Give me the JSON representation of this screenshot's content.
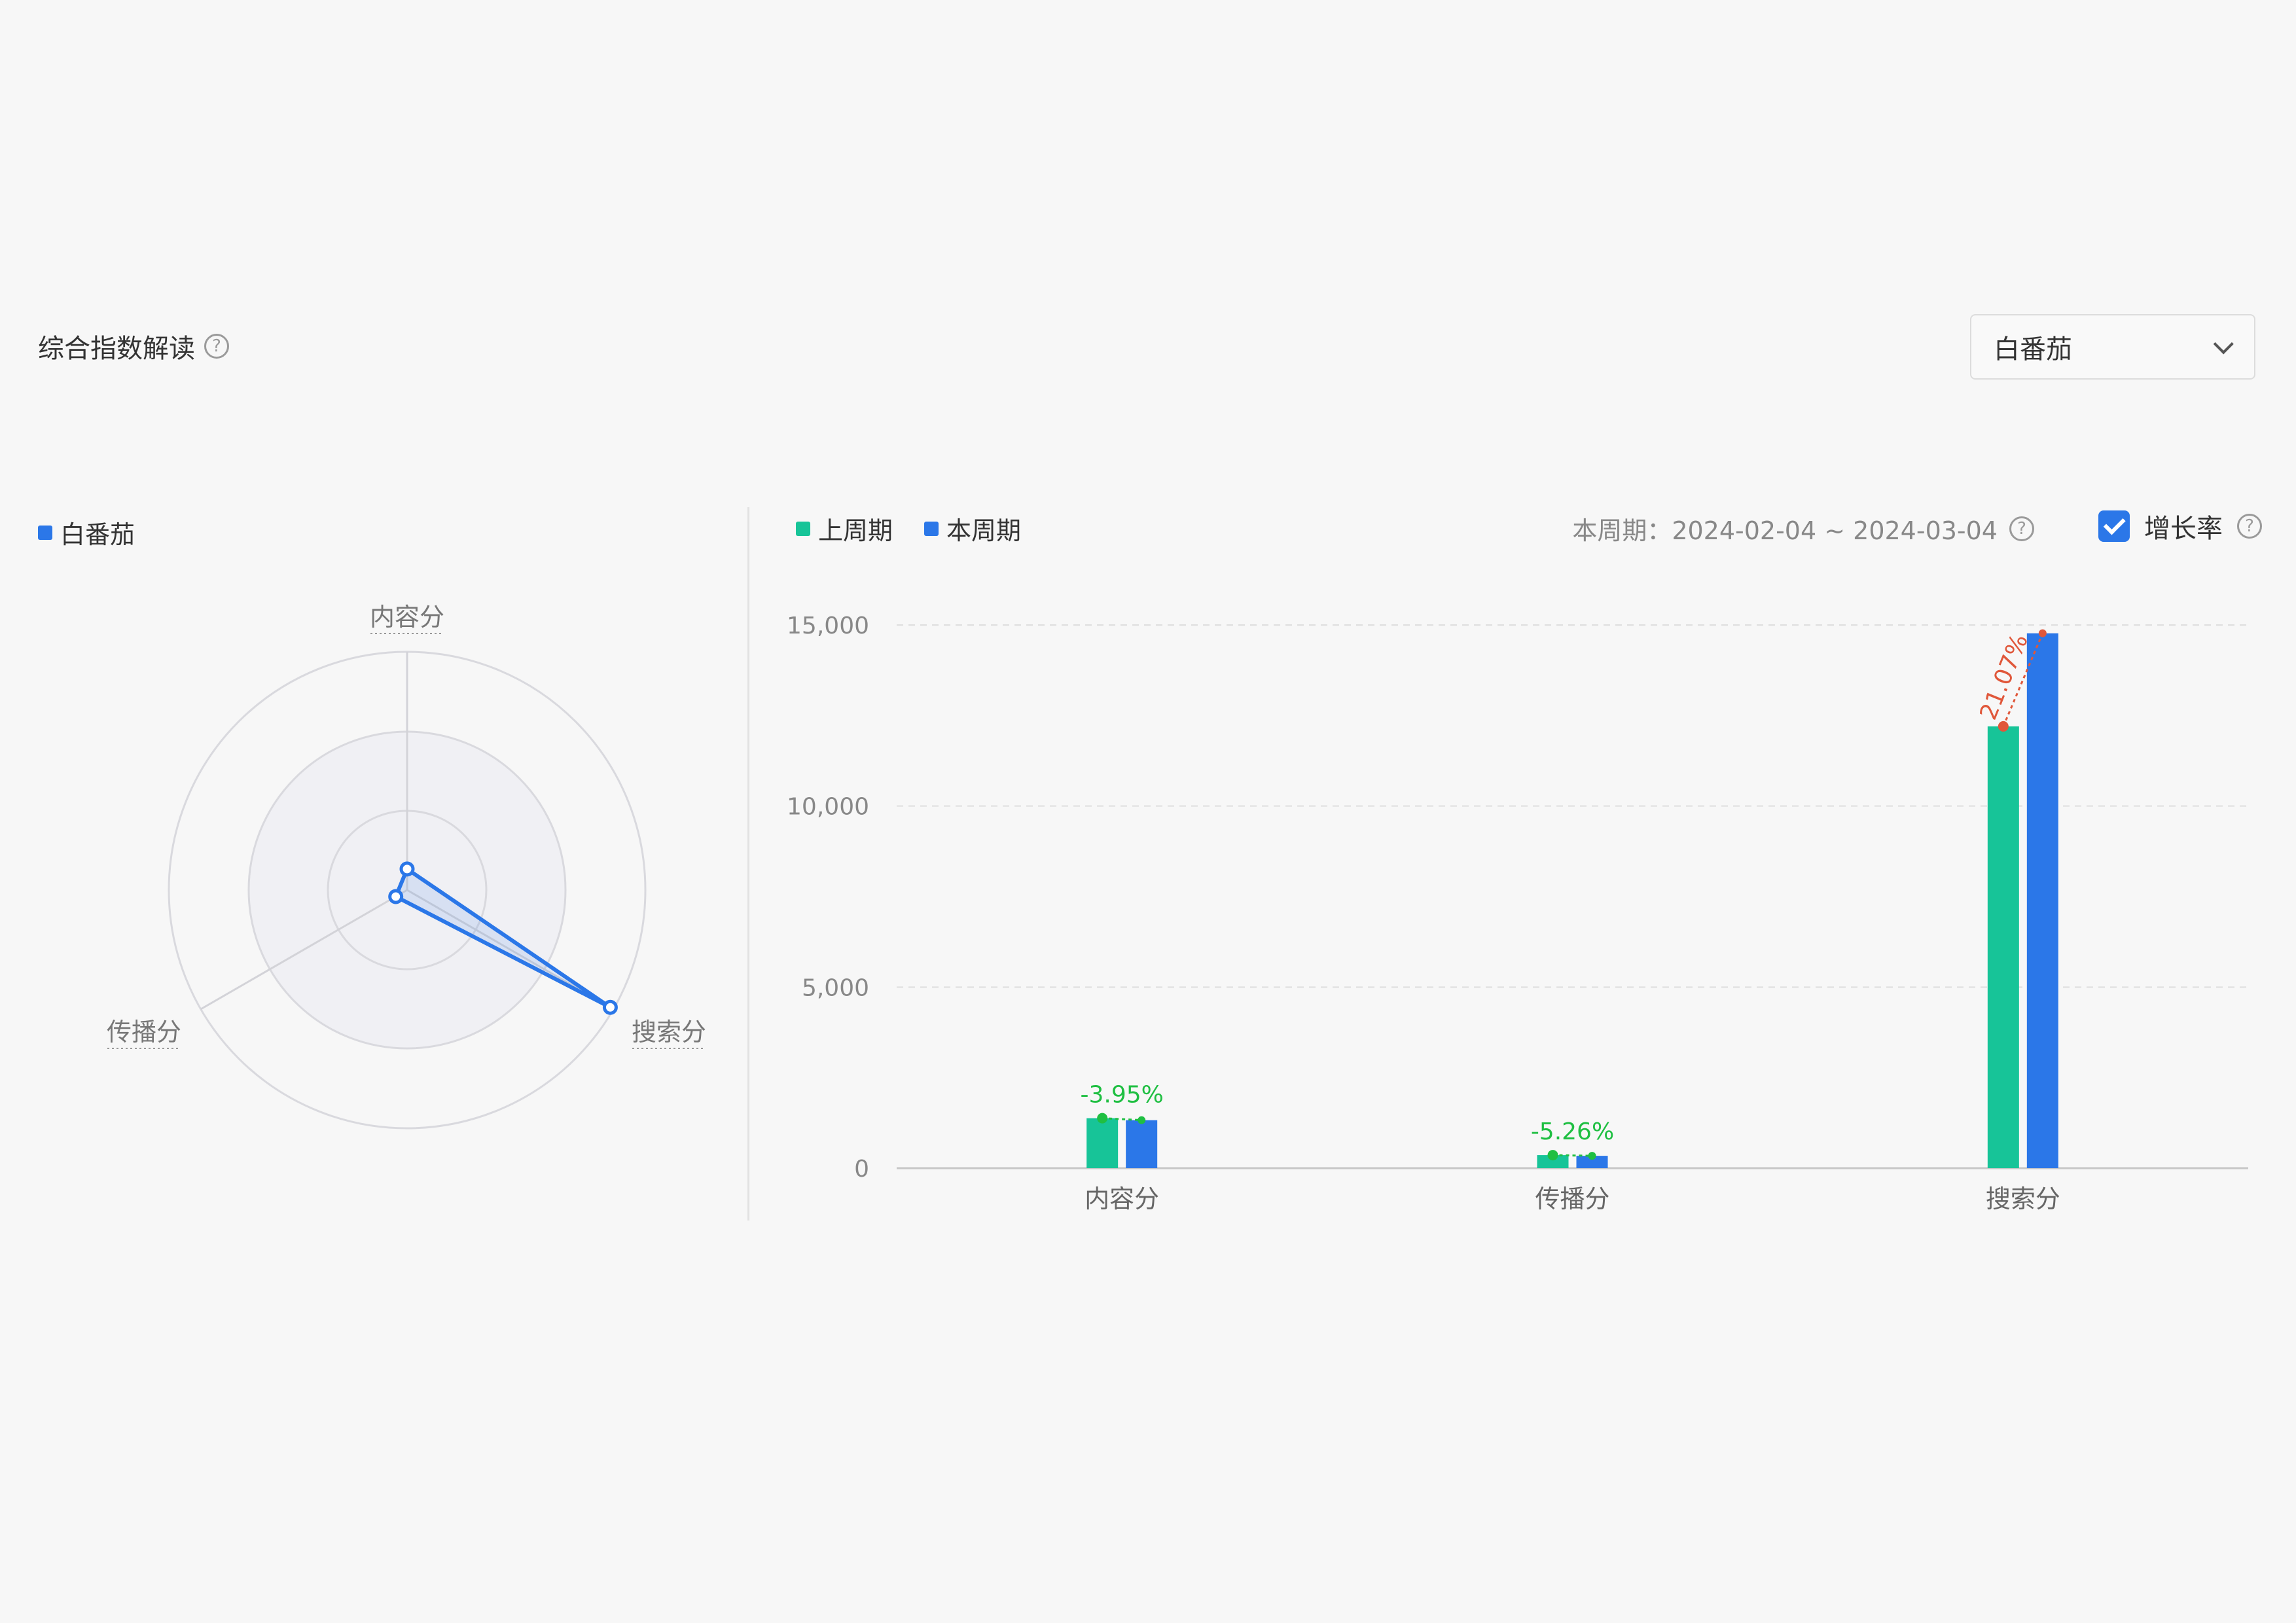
{
  "header": {
    "title": "综合指数解读",
    "select_value": "白番茄"
  },
  "radar": {
    "legend_label": "白番茄",
    "axes": [
      "内容分",
      "传播分",
      "搜索分"
    ]
  },
  "chart_header": {
    "period_text": "本周期：2024-02-04 ~ 2024-03-04",
    "growth_label": "增长率",
    "growth_checked": true
  },
  "colors": {
    "accent": "#2b77e8",
    "green": "#17c498",
    "blue": "#2b77e8",
    "red": "#e0573a",
    "growth_neg": "#1fbf42"
  },
  "chart_data": {
    "type": "bar",
    "categories": [
      "内容分",
      "传播分",
      "搜索分"
    ],
    "series": [
      {
        "name": "上周期",
        "values": [
          1380,
          360,
          12200
        ]
      },
      {
        "name": "本周期",
        "values": [
          1325,
          341,
          14771
        ]
      }
    ],
    "growth_labels": [
      "-3.95%",
      "-5.26%",
      "21.07%"
    ],
    "ylim": [
      0,
      15000
    ],
    "yticks": [
      0,
      5000,
      10000,
      15000
    ],
    "ytick_labels": [
      "0",
      "5,000",
      "10,000",
      "15,000"
    ],
    "grid": true,
    "legend_position": "top-left"
  }
}
